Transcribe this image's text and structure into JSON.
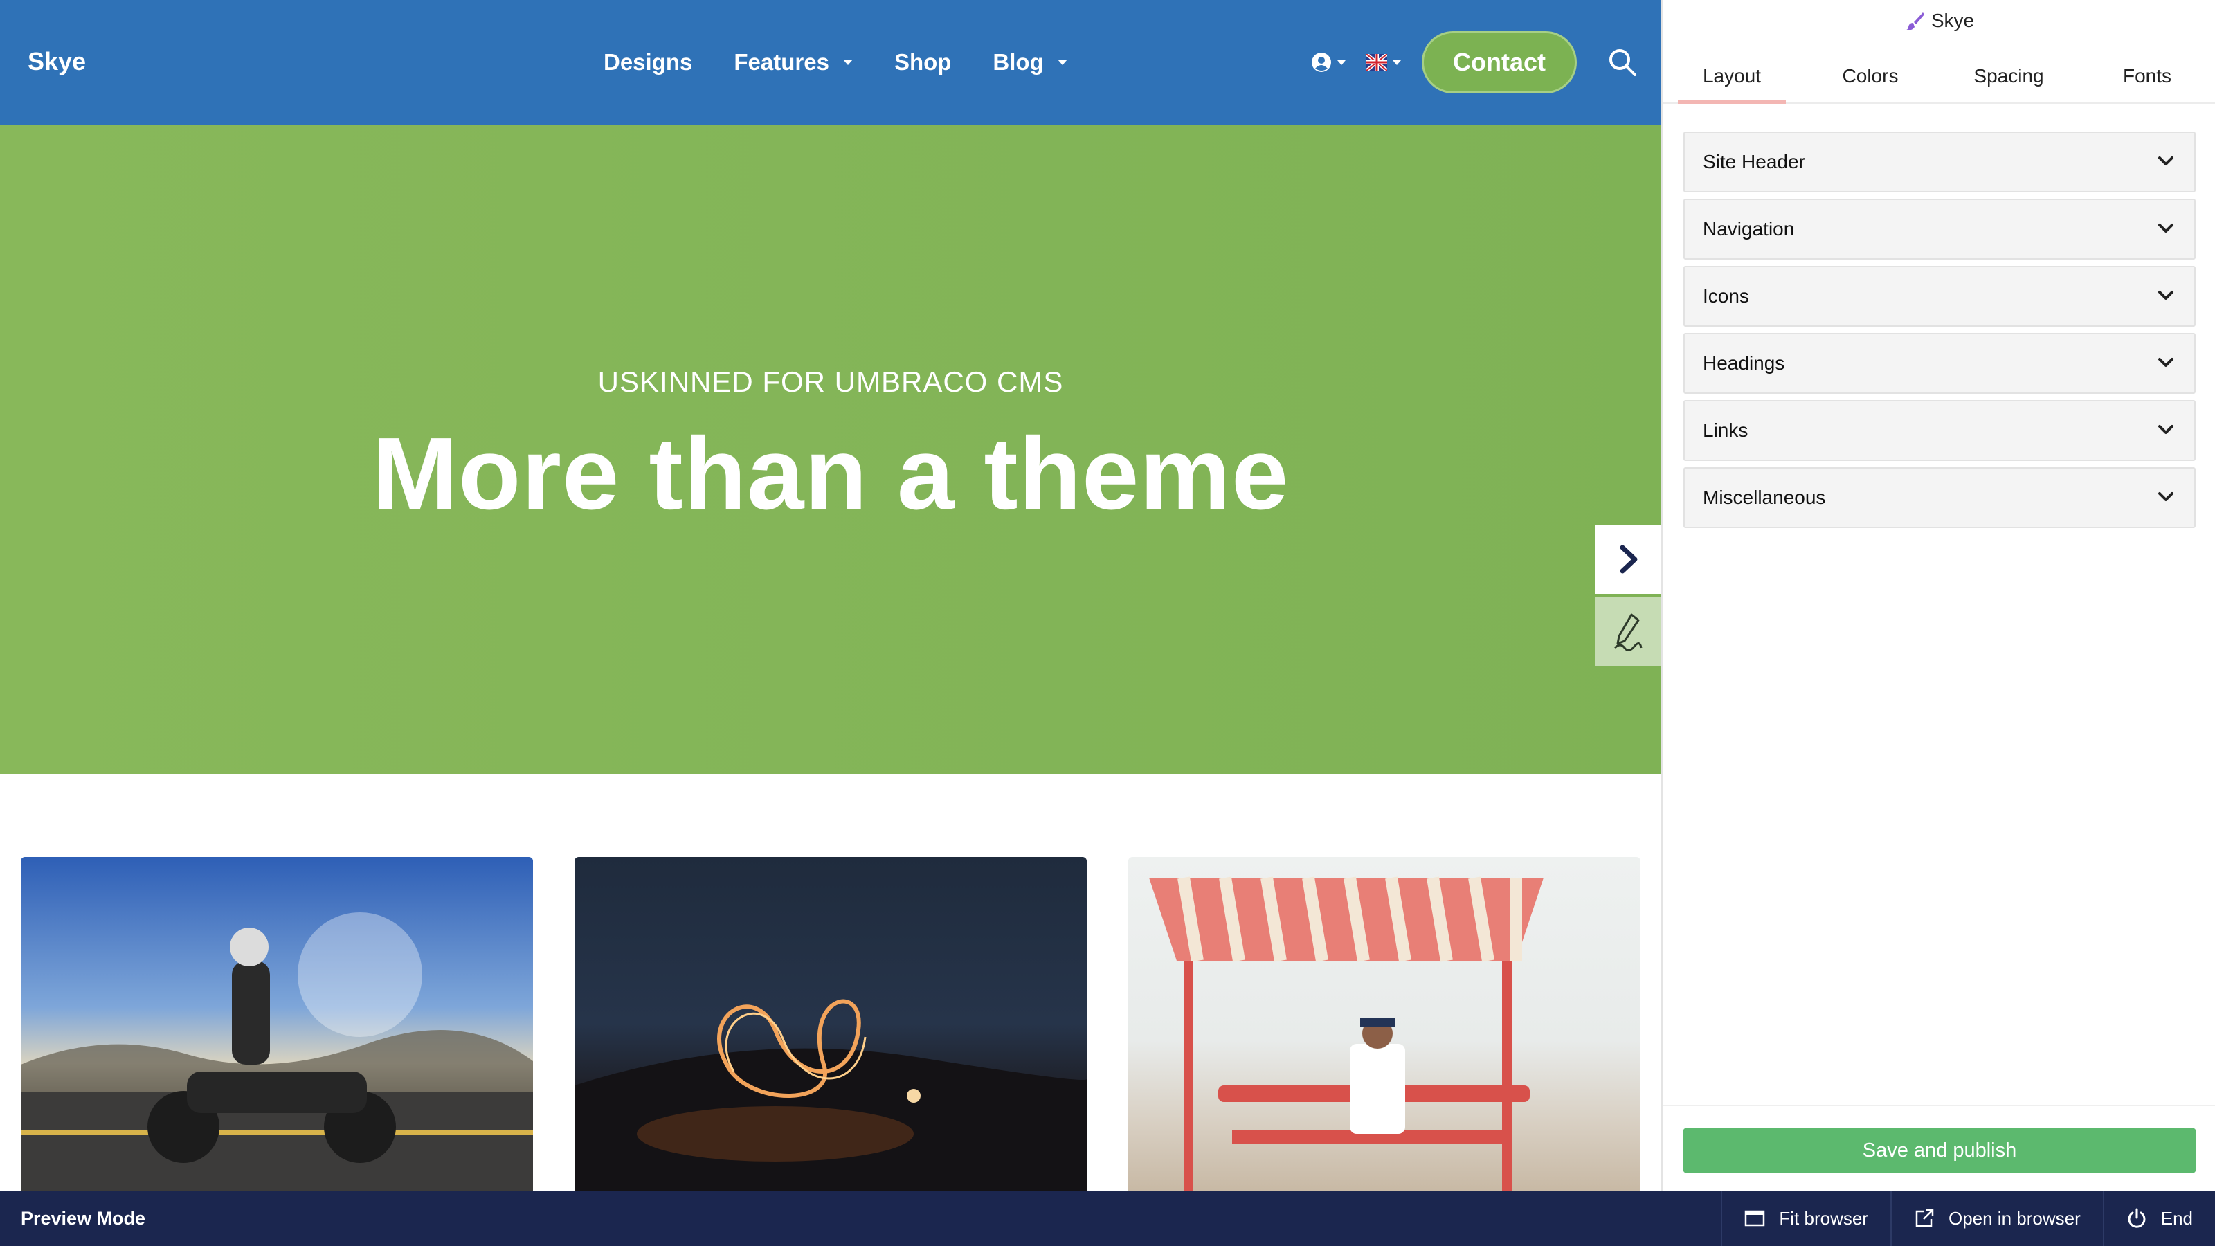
{
  "site": {
    "logo": "Skye",
    "nav": [
      {
        "label": "Designs",
        "dropdown": false
      },
      {
        "label": "Features",
        "dropdown": true
      },
      {
        "label": "Shop",
        "dropdown": false
      },
      {
        "label": "Blog",
        "dropdown": true
      }
    ],
    "header_tools": {
      "user_icon": "user-circle-icon",
      "language_icon": "uk-flag-icon",
      "contact_label": "Contact",
      "search_icon": "search-icon"
    },
    "hero": {
      "subtitle": "USKINNED FOR UMBRACO CMS",
      "title": "More than a theme"
    },
    "cards": [
      {
        "image": "motorcycle-rider-desert"
      },
      {
        "image": "light-painting-night-sky"
      },
      {
        "image": "beach-shade-bench"
      }
    ],
    "colors": {
      "header_bg": "#2f72b7",
      "hero_bg": "#82b456",
      "contact_bg": "#7cb252"
    }
  },
  "side_tabs": {
    "next_icon": "chevron-right-icon",
    "edit_icon": "pen-icon"
  },
  "panel": {
    "title": "Skye",
    "title_icon": "paint-brush-icon",
    "tabs": [
      {
        "label": "Layout",
        "active": true
      },
      {
        "label": "Colors",
        "active": false
      },
      {
        "label": "Spacing",
        "active": false
      },
      {
        "label": "Fonts",
        "active": false
      }
    ],
    "sections": [
      {
        "label": "Site Header"
      },
      {
        "label": "Navigation"
      },
      {
        "label": "Icons"
      },
      {
        "label": "Headings"
      },
      {
        "label": "Links"
      },
      {
        "label": "Miscellaneous"
      }
    ],
    "save_label": "Save and publish"
  },
  "bottom_bar": {
    "mode_label": "Preview Mode",
    "actions": [
      {
        "label": "Fit browser",
        "icon": "window-icon"
      },
      {
        "label": "Open in browser",
        "icon": "external-link-icon"
      },
      {
        "label": "End",
        "icon": "power-icon"
      }
    ]
  }
}
